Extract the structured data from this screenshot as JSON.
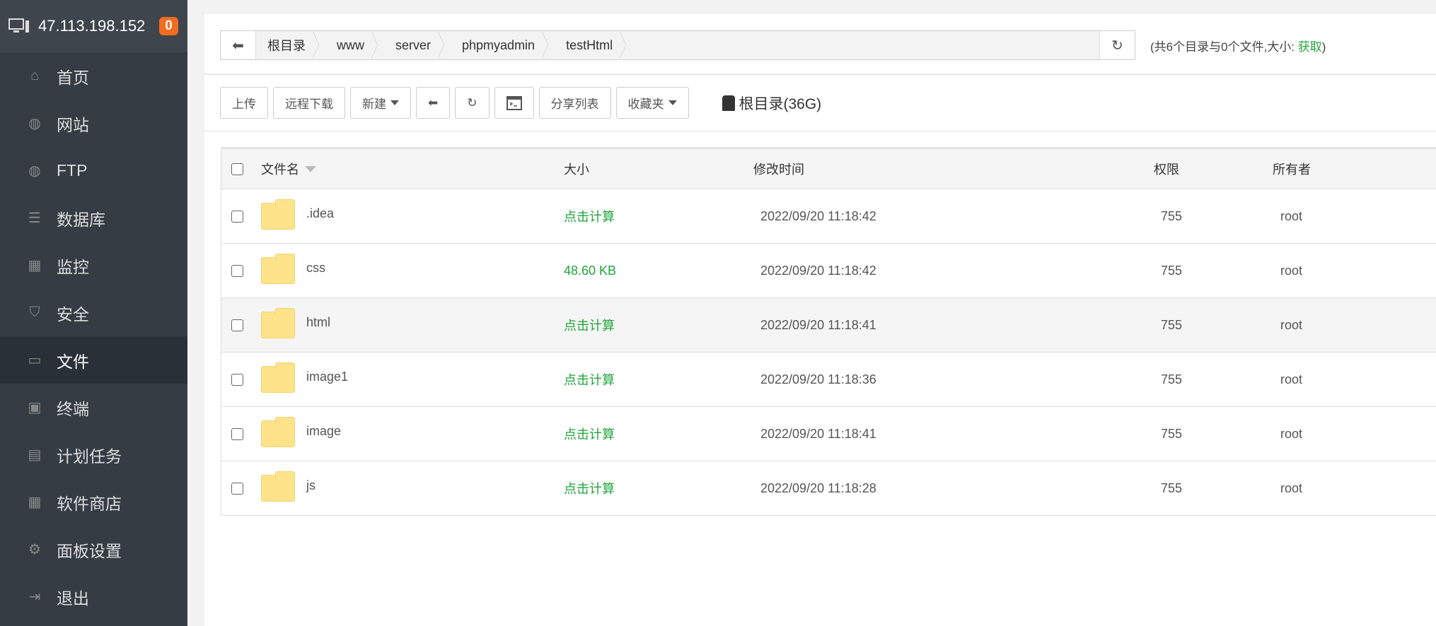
{
  "sidebar": {
    "server_ip": "47.113.198.152",
    "badge": "0",
    "items": [
      {
        "label": "首页",
        "icon": "home-icon"
      },
      {
        "label": "网站",
        "icon": "globe-icon"
      },
      {
        "label": "FTP",
        "icon": "ftp-icon"
      },
      {
        "label": "数据库",
        "icon": "database-icon"
      },
      {
        "label": "监控",
        "icon": "monitor-icon"
      },
      {
        "label": "安全",
        "icon": "shield-icon"
      },
      {
        "label": "文件",
        "icon": "folder-icon",
        "active": true
      },
      {
        "label": "终端",
        "icon": "terminal-icon"
      },
      {
        "label": "计划任务",
        "icon": "calendar-icon"
      },
      {
        "label": "软件商店",
        "icon": "grid-icon"
      },
      {
        "label": "面板设置",
        "icon": "gear-icon"
      },
      {
        "label": "退出",
        "icon": "logout-icon"
      }
    ]
  },
  "breadcrumb": [
    "根目录",
    "www",
    "server",
    "phpmyadmin",
    "testHtml"
  ],
  "info": {
    "prefix": "(共6个目录与0个文件,大小: ",
    "link": "获取",
    "suffix": ")"
  },
  "toolbar": {
    "upload": "上传",
    "remote_download": "远程下载",
    "new": "新建",
    "share_list": "分享列表",
    "favorites": "收藏夹",
    "disk": "根目录(36G)"
  },
  "table": {
    "headers": {
      "name": "文件名",
      "size": "大小",
      "time": "修改时间",
      "perm": "权限",
      "owner": "所有者"
    },
    "rows": [
      {
        "name": ".idea",
        "size": "点击计算",
        "time": "2022/09/20 11:18:42",
        "perm": "755",
        "owner": "root"
      },
      {
        "name": "css",
        "size": "48.60 KB",
        "time": "2022/09/20 11:18:42",
        "perm": "755",
        "owner": "root"
      },
      {
        "name": "html",
        "size": "点击计算",
        "time": "2022/09/20 11:18:41",
        "perm": "755",
        "owner": "root"
      },
      {
        "name": "image1",
        "size": "点击计算",
        "time": "2022/09/20 11:18:36",
        "perm": "755",
        "owner": "root"
      },
      {
        "name": "image",
        "size": "点击计算",
        "time": "2022/09/20 11:18:41",
        "perm": "755",
        "owner": "root"
      },
      {
        "name": "js",
        "size": "点击计算",
        "time": "2022/09/20 11:18:28",
        "perm": "755",
        "owner": "root"
      }
    ]
  },
  "colors": {
    "sidebar": "#353c44",
    "accent_green": "#20a53a",
    "badge": "#f46c1e",
    "folder": "#fee38a"
  }
}
